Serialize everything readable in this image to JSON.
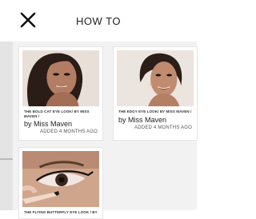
{
  "header": {
    "title": "HOW TO"
  },
  "cards": [
    {
      "caption": "THE BOLD CAT EYE LOOK/ BY MISS MAVEN /",
      "author": "by Miss Maven",
      "time": "ADDED 4 MONTHS AGO"
    },
    {
      "caption": "THE EDGY EYE LOOK/ BY MISS MAVEN /",
      "author": "by Miss Maven",
      "time": "ADDED 4 MONTHS AGO"
    },
    {
      "caption": "THE FLYING BUTTERFLY EYE LOOK / BY",
      "author": "",
      "time": ""
    }
  ]
}
